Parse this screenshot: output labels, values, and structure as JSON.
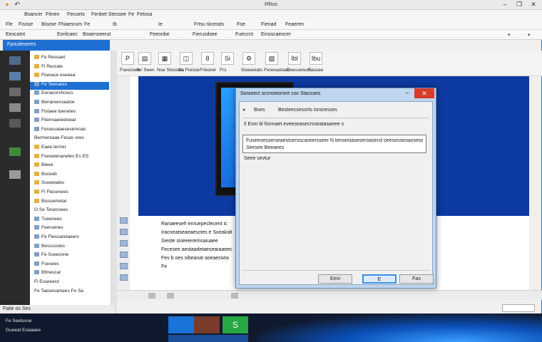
{
  "window": {
    "title": "Rfitus",
    "min_glyph": "–",
    "max_glyph": "❐",
    "close_glyph": "✕"
  },
  "menu": [
    "Bsancer",
    "Fitnen",
    "Fecuets",
    "Fenbet Stessee",
    "Fe",
    "Fetosa"
  ],
  "ribbon_tabs": [
    "Fle",
    "Fissse",
    "Bisose",
    "Fhiaesrum",
    "Fe",
    "Ib",
    "Ie",
    "Frtsu tiicerats",
    "Foe",
    "Fienad",
    "Feaeren"
  ],
  "ribbon_sub": [
    "Eescatnt",
    "Eorilcaec",
    "Bsaenseerut",
    "Feeonbe",
    "Fierusdsee",
    "Fueccnt",
    "Einsscaeocer"
  ],
  "blue_tab": "Fpouiteseres",
  "nav_items": [
    {
      "label": "Fe Ressaet",
      "selected": false,
      "icon": "folder"
    },
    {
      "label": "Fi Recrate",
      "selected": false,
      "icon": "folder"
    },
    {
      "label": "Fiwoase eseeea",
      "selected": false,
      "icon": "folder"
    },
    {
      "label": "Fe Teenares",
      "selected": true,
      "icon": "doc"
    },
    {
      "label": "Eenacorshcecs",
      "selected": false,
      "icon": "doc"
    },
    {
      "label": "Benareeroaatoe",
      "selected": false,
      "icon": "doc"
    },
    {
      "label": "Fistaee toenetes",
      "selected": false,
      "icon": "doc"
    },
    {
      "label": "Fitennaeieetoear",
      "selected": false,
      "icon": "doc"
    },
    {
      "label": "Fenacuaaesesenroac",
      "selected": false,
      "icon": "doc"
    },
    {
      "label": "Bermereaae Fesas ores",
      "selected": false,
      "icon": "none"
    },
    {
      "label": "Eaee terrrer",
      "selected": false,
      "icon": "folder"
    },
    {
      "label": "Fsesetenanetes Es ES",
      "selected": false,
      "icon": "folder"
    },
    {
      "label": "Bieee",
      "selected": false,
      "icon": "folder"
    },
    {
      "label": "Bsceeb",
      "selected": false,
      "icon": "folder"
    },
    {
      "label": "Ssueeiates",
      "selected": false,
      "icon": "folder"
    },
    {
      "label": "Fi Ftecenees",
      "selected": false,
      "icon": "folder"
    },
    {
      "label": "Bisssemetar",
      "selected": false,
      "icon": "folder"
    },
    {
      "label": "O Se Tesessees",
      "selected": false,
      "icon": "none"
    },
    {
      "label": "Tueenees",
      "selected": false,
      "icon": "doc"
    },
    {
      "label": "Feersenes",
      "selected": false,
      "icon": "doc"
    },
    {
      "label": "Fe Ftessaretaeers",
      "selected": false,
      "icon": "doc"
    },
    {
      "label": "Bessssstes",
      "selected": false,
      "icon": "doc"
    },
    {
      "label": "Fe Sseesnne",
      "selected": false,
      "icon": "doc"
    },
    {
      "label": "Fsesees",
      "selected": false,
      "icon": "doc"
    },
    {
      "label": "Bfmescar",
      "selected": false,
      "icon": "doc"
    },
    {
      "label": "Fi Esseeerd",
      "selected": false,
      "icon": "none"
    },
    {
      "label": "Fe Taeoesamees Fe Sa",
      "selected": false,
      "icon": "none"
    }
  ],
  "toolbar": [
    {
      "icon": "P",
      "label": "Fsesoseh"
    },
    {
      "icon": "▤",
      "label": "Ier Seen"
    },
    {
      "icon": "▦",
      "label": "Nse Stosses"
    },
    {
      "icon": "◫",
      "label": "Sa Fresse"
    },
    {
      "icon": "8",
      "label": "Frteorer"
    },
    {
      "icon": "Si",
      "label": "Frs"
    },
    {
      "icon": "⚙",
      "label": "Siseeeiats"
    },
    {
      "icon": "▧",
      "label": "Fenesastaes"
    },
    {
      "icon": "Ibl",
      "label": "Esesseiscrs"
    },
    {
      "icon": "Ibu",
      "label": "Fassee"
    }
  ],
  "doc_lines": [
    "Ranaeeseh enruepeclecent ic",
    "Iracneatseaeaesctes e Soeakalt",
    "Sieste siseeieremsaiuaee",
    "Fecesee aestaadeiaesearaaeec",
    "Fes b oes sibeanat aseaessea",
    "Fe"
  ],
  "dialog": {
    "title": "Sorasect sccnoeiorsre coc Stacsses",
    "row1_a": "Bses",
    "row1_b": "Besteecsesorts isnsresses",
    "row2": "Il Esm bl fisnnaet eveeseasecrsseatasaeee s",
    "input_line1": "Fuseeoesserseaestsersscaseersseer N tensestaseseroasecd oeesesseoaosesescaoea",
    "input_line2": "Seesee Beeaees",
    "row3": "Seee sevtur",
    "btn_cancel": "Eeni",
    "btn_ok": "E",
    "btn_other": "Fas"
  },
  "status": {
    "bottom_left": "Fatie os Ses"
  },
  "tray": [
    "Fe Seetuvse",
    "Gueeat Eoaaaee"
  ],
  "colors": {
    "accent": "#1e6fd1",
    "close": "#d83b2a",
    "tile_blue": "#1a73d9",
    "tile_green": "#28a745"
  }
}
